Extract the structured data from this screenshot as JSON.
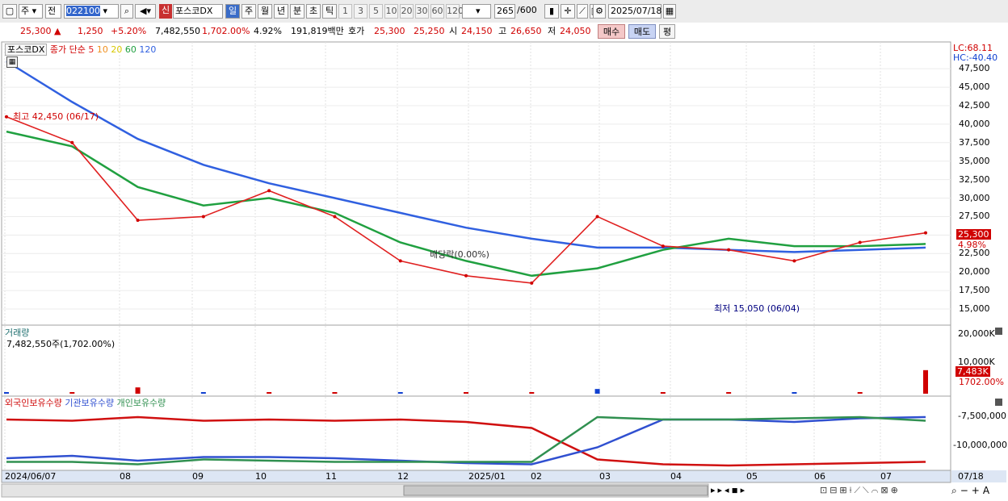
{
  "toolbar": {
    "market": "주",
    "period_mode": "전",
    "code": "022100",
    "credit_badge": "신",
    "stock_name": "포스코DX",
    "periods": [
      "일",
      "주",
      "월",
      "년",
      "분",
      "초",
      "틱"
    ],
    "minute_options": [
      "1",
      "3",
      "5",
      "10",
      "20",
      "30",
      "60",
      "120"
    ],
    "count": "265",
    "count_total": "/600",
    "date": "2025/07/18"
  },
  "quote": {
    "price": "25,300",
    "change": "1,250",
    "change_pct": "+5.20%",
    "volume": "7,482,550",
    "volume_ratio": "1,702.00%",
    "turnover": "4.92%",
    "amount": "191,819백만",
    "bid_label": "호가",
    "bid1": "25,300",
    "bid2": "25,250",
    "open_label": "시",
    "open": "24,150",
    "high_label": "고",
    "high": "26,650",
    "low_label": "저",
    "low": "24,050",
    "buy": "매수",
    "sell": "매도",
    "eval": "평"
  },
  "legend": {
    "name": "포스코DX",
    "label": "종가 단순",
    "ma": [
      "5",
      "10",
      "20",
      "60",
      "120"
    ]
  },
  "annotations": {
    "high": "최고 42,450 (06/17)",
    "low": "최저 15,050 (06/04)",
    "dividend": "배당락(0.00%)"
  },
  "axis_info": {
    "lc": "LC:68.11",
    "hc": "HC:-40.40"
  },
  "price_axis": [
    "47,500",
    "45,000",
    "42,500",
    "40,000",
    "37,500",
    "35,000",
    "32,500",
    "30,000",
    "27,500",
    "25,000",
    "22,500",
    "20,000",
    "17,500",
    "15,000"
  ],
  "price_tag": {
    "price": "25,300",
    "pct": "4.98%"
  },
  "volume_panel": {
    "title": "거래량",
    "info": "7,482,550주(1,702.00%)",
    "axis": [
      "20,000K",
      "10,000K"
    ],
    "tag_value": "7,483K",
    "tag_pct": "1702.00%"
  },
  "holding_panel": {
    "legend": [
      "외국인보유수량",
      "기관보유수량",
      "개인보유수량"
    ],
    "axis": [
      "-7,500,000",
      "-10,000,000"
    ]
  },
  "date_axis": [
    "2024/06/07",
    "08",
    "09",
    "10",
    "11",
    "12",
    "2025/01",
    "02",
    "03",
    "04",
    "05",
    "06",
    "07",
    "07/18"
  ],
  "colors": {
    "up": "#d00000",
    "down": "#1040d0",
    "ma5": "#e02020",
    "ma10": "#f09020",
    "ma20": "#f0e020",
    "ma60": "#20a040",
    "ma120": "#3060e0",
    "foreign": "#d01010",
    "institution": "#3050d0",
    "individual": "#309050"
  },
  "chart_data": {
    "type": "line",
    "x": [
      "2024/06/07",
      "2024/07",
      "2024/08",
      "2024/09",
      "2024/10",
      "2024/11",
      "2024/12",
      "2025/01",
      "2025/02",
      "2025/03",
      "2025/04",
      "2025/05",
      "2025/06",
      "2025/07",
      "2025/07/18"
    ],
    "series": [
      {
        "values": [
          41000,
          37500,
          27000,
          27500,
          31000,
          27500,
          21500,
          19500,
          18500,
          27500,
          23500,
          23000,
          21500,
          24000,
          25300
        ]
      },
      {
        "values": [
          48500,
          43000,
          38000,
          34500,
          32000,
          30000,
          28000,
          26000,
          24500,
          23300,
          23300,
          23000,
          22700,
          23000,
          23300
        ]
      },
      {
        "values": [
          39000,
          37000,
          31500,
          29000,
          30000,
          28000,
          24000,
          21500,
          19500,
          20500,
          23000,
          24500,
          23500,
          23500,
          23800
        ]
      },
      {
        "values": [
          120000,
          180000,
          2000000,
          350000,
          400000,
          300000,
          200000,
          180000,
          150000,
          1500000,
          200000,
          150000,
          400000,
          300000,
          7482550
        ]
      },
      {
        "values": [
          -7500000,
          -7600000,
          -7300000,
          -7600000,
          -7500000,
          -7600000,
          -7500000,
          -7700000,
          -8200000,
          -10800000,
          -11200000,
          -11300000,
          -11200000,
          -11100000,
          -11000000
        ]
      },
      {
        "values": [
          -10700000,
          -10500000,
          -10900000,
          -10600000,
          -10600000,
          -10700000,
          -10900000,
          -11100000,
          -11200000,
          -9800000,
          -7500000,
          -7500000,
          -7700000,
          -7400000,
          -7300000
        ]
      },
      {
        "values": [
          -11000000,
          -11000000,
          -11200000,
          -10800000,
          -10900000,
          -11000000,
          -11000000,
          -11000000,
          -11000000,
          -7300000,
          -7500000,
          -7500000,
          -7400000,
          -7300000,
          -7600000
        ]
      }
    ],
    "ylim": [
      15000,
      48500
    ]
  }
}
